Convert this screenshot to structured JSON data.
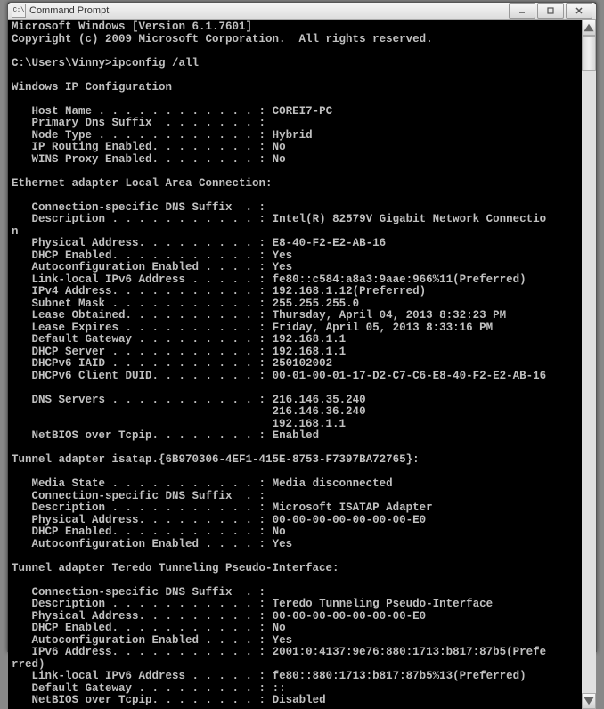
{
  "window": {
    "title": "Command Prompt",
    "icon_label": "C:\\"
  },
  "terminal": {
    "banner1": "Microsoft Windows [Version 6.1.7601]",
    "banner2": "Copyright (c) 2009 Microsoft Corporation.  All rights reserved.",
    "prompt": "C:\\Users\\Vinny>ipconfig /all",
    "heading_ipconfig": "Windows IP Configuration",
    "hostname_label": "   Host Name . . . . . . . . . . . . : ",
    "hostname_value": "COREI7-PC",
    "primarydns_label": "   Primary Dns Suffix  . . . . . . . :",
    "primarydns_value": "",
    "nodetype_label": "   Node Type . . . . . . . . . . . . : ",
    "nodetype_value": "Hybrid",
    "iprouting_label": "   IP Routing Enabled. . . . . . . . : ",
    "iprouting_value": "No",
    "winsproxy_label": "   WINS Proxy Enabled. . . . . . . . : ",
    "winsproxy_value": "No",
    "heading_eth": "Ethernet adapter Local Area Connection:",
    "eth_conndns_label": "   Connection-specific DNS Suffix  . :",
    "eth_conndns_value": "",
    "eth_desc_label": "   Description . . . . . . . . . . . : ",
    "eth_desc_value": "Intel(R) 82579V Gigabit Network Connectio",
    "eth_desc_wrap": "n",
    "eth_phys_label": "   Physical Address. . . . . . . . . : ",
    "eth_phys_value": "E8-40-F2-E2-AB-16",
    "eth_dhcp_label": "   DHCP Enabled. . . . . . . . . . . : ",
    "eth_dhcp_value": "Yes",
    "eth_autoconf_label": "   Autoconfiguration Enabled . . . . : ",
    "eth_autoconf_value": "Yes",
    "eth_linklocal_label": "   Link-local IPv6 Address . . . . . : ",
    "eth_linklocal_value": "fe80::c584:a8a3:9aae:966%11(Preferred)",
    "eth_ipv4_label": "   IPv4 Address. . . . . . . . . . . : ",
    "eth_ipv4_value": "192.168.1.12(Preferred)",
    "eth_subnet_label": "   Subnet Mask . . . . . . . . . . . : ",
    "eth_subnet_value": "255.255.255.0",
    "eth_leaseobt_label": "   Lease Obtained. . . . . . . . . . : ",
    "eth_leaseobt_value": "Thursday, April 04, 2013 8:32:23 PM",
    "eth_leaseexp_label": "   Lease Expires . . . . . . . . . . : ",
    "eth_leaseexp_value": "Friday, April 05, 2013 8:33:16 PM",
    "eth_gateway_label": "   Default Gateway . . . . . . . . . : ",
    "eth_gateway_value": "192.168.1.1",
    "eth_dhcpsrv_label": "   DHCP Server . . . . . . . . . . . : ",
    "eth_dhcpsrv_value": "192.168.1.1",
    "eth_iaid_label": "   DHCPv6 IAID . . . . . . . . . . . : ",
    "eth_iaid_value": "250102002",
    "eth_duid_label": "   DHCPv6 Client DUID. . . . . . . . : ",
    "eth_duid_value": "00-01-00-01-17-D2-C7-C6-E8-40-F2-E2-AB-16",
    "eth_dns_label": "   DNS Servers . . . . . . . . . . . : ",
    "eth_dns1": "216.146.35.240",
    "eth_dns2": "                                       216.146.36.240",
    "eth_dns3": "                                       192.168.1.1",
    "eth_netbios_label": "   NetBIOS over Tcpip. . . . . . . . : ",
    "eth_netbios_value": "Enabled",
    "heading_isatap": "Tunnel adapter isatap.{6B970306-4EF1-415E-8753-F7397BA72765}:",
    "isa_media_label": "   Media State . . . . . . . . . . . : ",
    "isa_media_value": "Media disconnected",
    "isa_conndns_label": "   Connection-specific DNS Suffix  . :",
    "isa_conndns_value": "",
    "isa_desc_label": "   Description . . . . . . . . . . . : ",
    "isa_desc_value": "Microsoft ISATAP Adapter",
    "isa_phys_label": "   Physical Address. . . . . . . . . : ",
    "isa_phys_value": "00-00-00-00-00-00-00-E0",
    "isa_dhcp_label": "   DHCP Enabled. . . . . . . . . . . : ",
    "isa_dhcp_value": "No",
    "isa_autoconf_label": "   Autoconfiguration Enabled . . . . : ",
    "isa_autoconf_value": "Yes",
    "heading_teredo": "Tunnel adapter Teredo Tunneling Pseudo-Interface:",
    "ter_conndns_label": "   Connection-specific DNS Suffix  . :",
    "ter_conndns_value": "",
    "ter_desc_label": "   Description . . . . . . . . . . . : ",
    "ter_desc_value": "Teredo Tunneling Pseudo-Interface",
    "ter_phys_label": "   Physical Address. . . . . . . . . : ",
    "ter_phys_value": "00-00-00-00-00-00-00-E0",
    "ter_dhcp_label": "   DHCP Enabled. . . . . . . . . . . : ",
    "ter_dhcp_value": "No",
    "ter_autoconf_label": "   Autoconfiguration Enabled . . . . : ",
    "ter_autoconf_value": "Yes",
    "ter_ipv6_label": "   IPv6 Address. . . . . . . . . . . : ",
    "ter_ipv6_value": "2001:0:4137:9e76:880:1713:b817:87b5(Prefe",
    "ter_ipv6_wrap": "rred)",
    "ter_linklocal_label": "   Link-local IPv6 Address . . . . . : ",
    "ter_linklocal_value": "fe80::880:1713:b817:87b5%13(Preferred)",
    "ter_gateway_label": "   Default Gateway . . . . . . . . . : ",
    "ter_gateway_value": "::",
    "ter_netbios_label": "   NetBIOS over Tcpip. . . . . . . . : ",
    "ter_netbios_value": "Disabled"
  }
}
